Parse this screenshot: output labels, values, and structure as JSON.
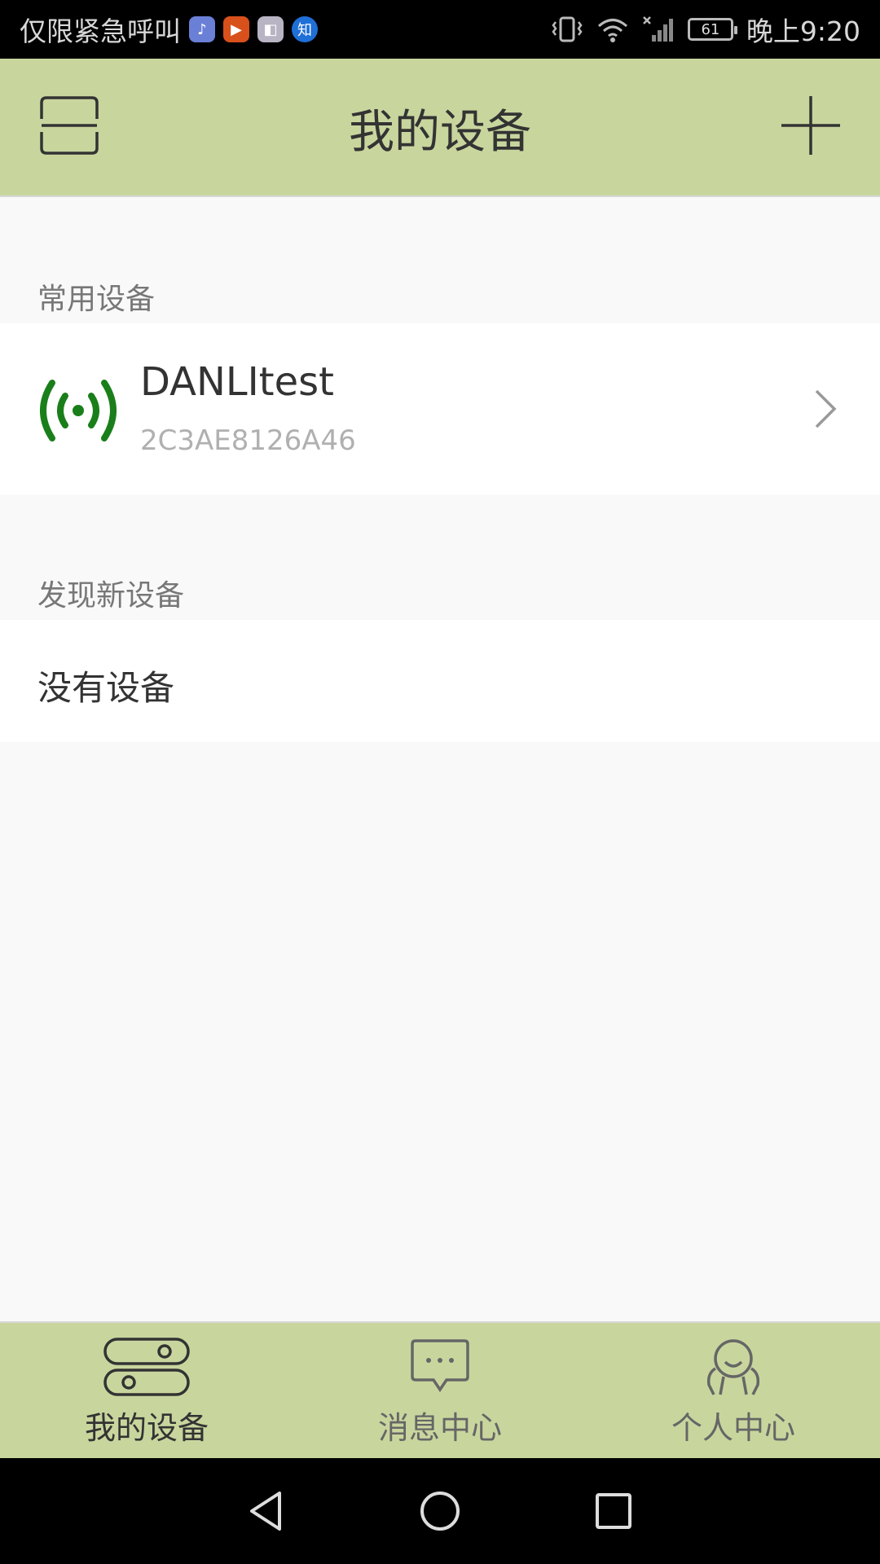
{
  "status_bar": {
    "carrier": "仅限紧急呼叫",
    "app_icons": [
      "music-icon",
      "video-icon",
      "gallery-icon",
      "zhihu-icon"
    ],
    "zhihu_label": "知",
    "battery": "61",
    "time": "晚上9:20"
  },
  "header": {
    "title": "我的设备",
    "left_icon": "scan-icon",
    "right_icon": "plus-icon"
  },
  "sections": {
    "common_title": "常用设备",
    "discover_title": "发现新设备"
  },
  "device": {
    "name": "DANLItest",
    "mac": "2C3AE8126A46",
    "icon": "signal-broadcast-icon"
  },
  "empty": {
    "text": "没有设备"
  },
  "bottom_nav": {
    "items": [
      {
        "label": "我的设备",
        "icon": "devices-icon",
        "active": true
      },
      {
        "label": "消息中心",
        "icon": "message-icon",
        "active": false
      },
      {
        "label": "个人中心",
        "icon": "person-icon",
        "active": false
      }
    ]
  },
  "colors": {
    "accent": "#c8d69e",
    "device_icon": "#1a7f1a"
  }
}
